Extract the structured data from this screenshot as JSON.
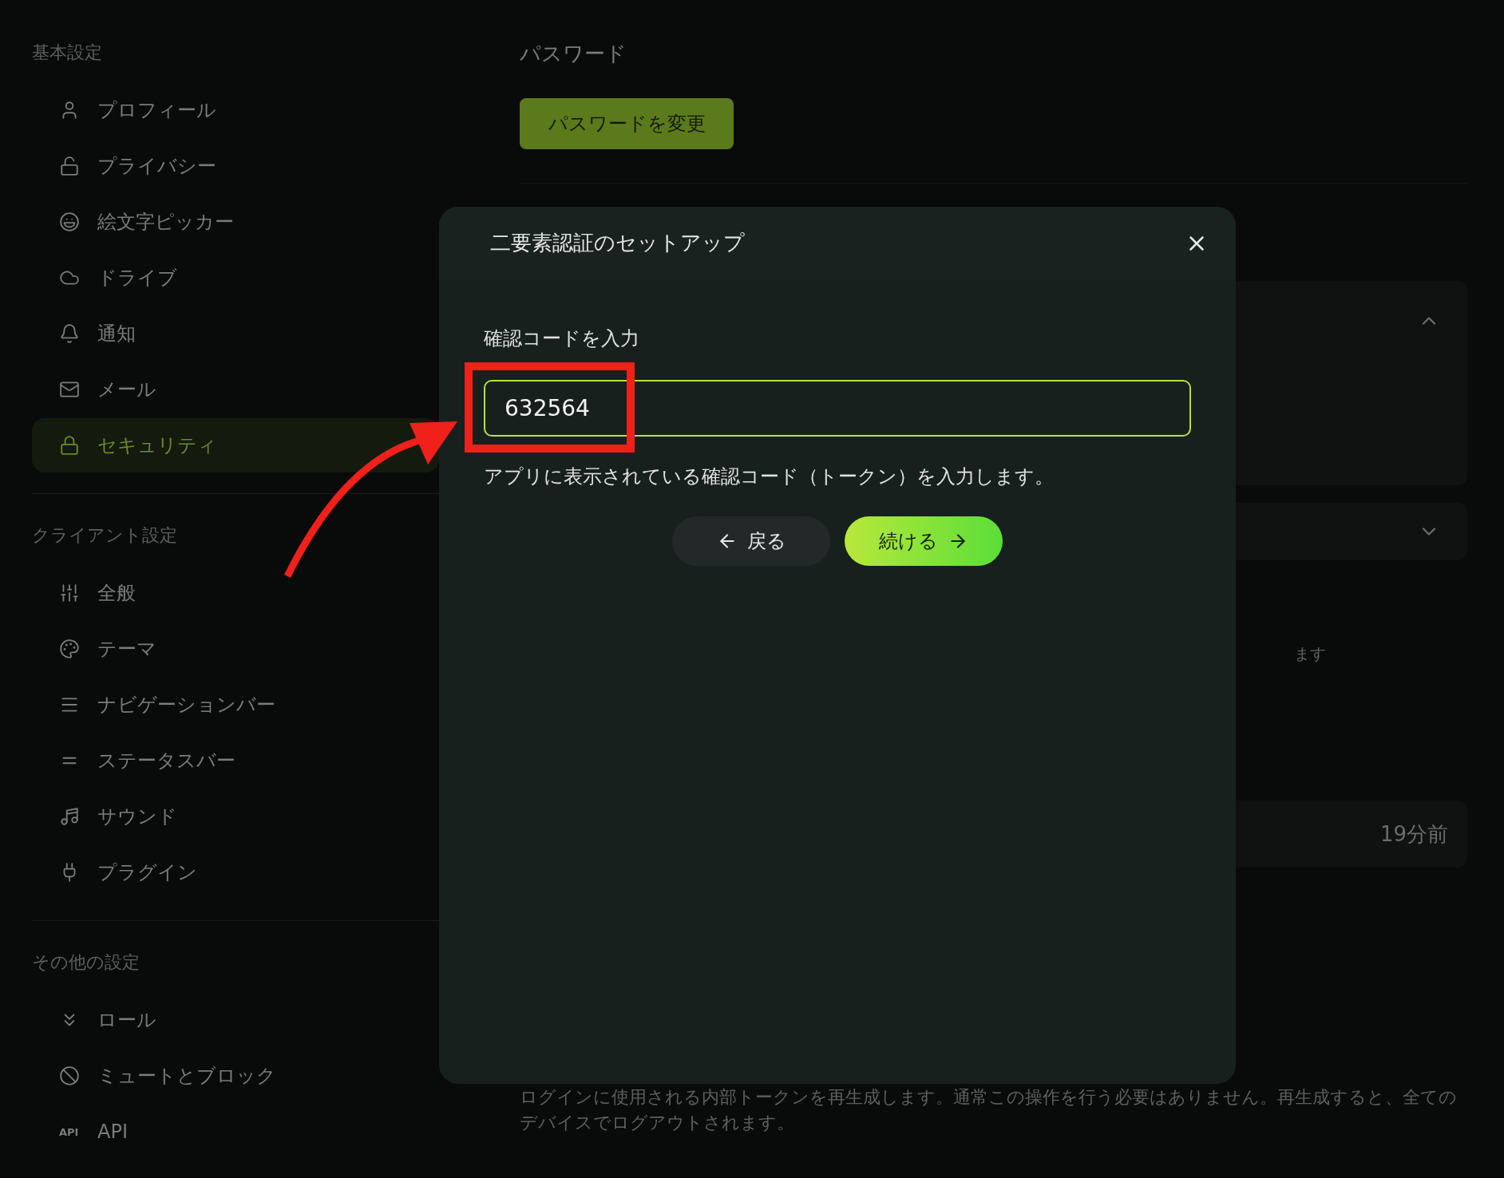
{
  "sidebar": {
    "sections": [
      {
        "heading": "基本設定",
        "items": [
          {
            "label": "プロフィール",
            "selected": false
          },
          {
            "label": "プライバシー",
            "selected": false
          },
          {
            "label": "絵文字ピッカー",
            "selected": false
          },
          {
            "label": "ドライブ",
            "selected": false
          },
          {
            "label": "通知",
            "selected": false
          },
          {
            "label": "メール",
            "selected": false
          },
          {
            "label": "セキュリティ",
            "selected": true
          }
        ]
      },
      {
        "heading": "クライアント設定",
        "items": [
          {
            "label": "全般",
            "selected": false
          },
          {
            "label": "テーマ",
            "selected": false
          },
          {
            "label": "ナビゲーションバー",
            "selected": false
          },
          {
            "label": "ステータスバー",
            "selected": false
          },
          {
            "label": "サウンド",
            "selected": false
          },
          {
            "label": "プラグイン",
            "selected": false
          }
        ]
      },
      {
        "heading": "その他の設定",
        "items": [
          {
            "label": "ロール",
            "selected": false
          },
          {
            "label": "ミュートとブロック",
            "selected": false
          },
          {
            "label": "API",
            "selected": false,
            "icon_text": "API"
          }
        ]
      }
    ]
  },
  "main": {
    "password_heading": "パスワード",
    "password_button": "パスワードを変更",
    "cards": [
      {
        "expanded": true
      },
      {
        "expanded": false
      }
    ],
    "partial_text": "ます",
    "session_time": "19分前",
    "regenerate_note": "ログインに使用される内部トークンを再生成します。通常この操作を行う必要はありません。再生成すると、全てのデバイスでログアウトされます。"
  },
  "dialog": {
    "title": "二要素認証のセットアップ",
    "field_label": "確認コードを入力",
    "code": "632564",
    "hint": "アプリに表示されている確認コード（トークン）を入力します。",
    "back_button": "戻る",
    "continue_button": "続ける"
  }
}
